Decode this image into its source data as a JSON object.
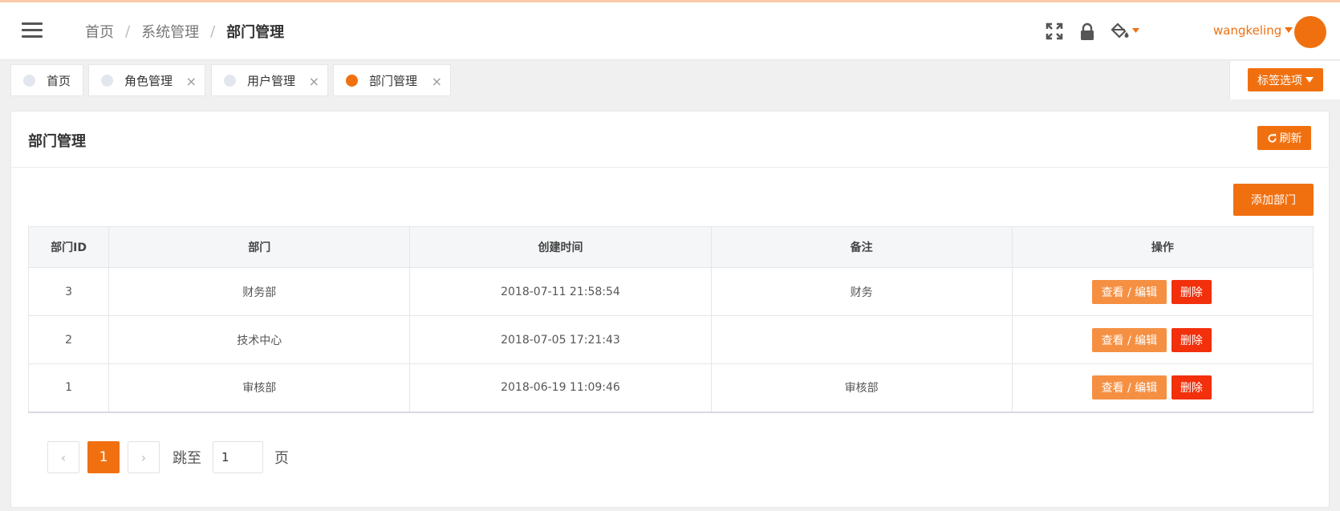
{
  "header": {
    "breadcrumb": [
      "首页",
      "系统管理",
      "部门管理"
    ],
    "separator": "/",
    "username": "wangkeling",
    "accent_color": "#f07010",
    "icons": [
      "fullscreen-icon",
      "lock-icon",
      "paint-bucket-icon"
    ]
  },
  "tabs": {
    "items": [
      {
        "label": "首页",
        "active": false,
        "closable": false
      },
      {
        "label": "角色管理",
        "active": false,
        "closable": true
      },
      {
        "label": "用户管理",
        "active": false,
        "closable": true
      },
      {
        "label": "部门管理",
        "active": true,
        "closable": true
      }
    ],
    "close_glyph": "×",
    "options_label": "标签选项"
  },
  "card": {
    "title": "部门管理",
    "refresh_label": "刷新",
    "add_label": "添加部门"
  },
  "table": {
    "columns": [
      "部门ID",
      "部门",
      "创建时间",
      "备注",
      "操作"
    ],
    "rows": [
      {
        "id": "3",
        "name": "财务部",
        "created": "2018-07-11 21:58:54",
        "remark": "财务"
      },
      {
        "id": "2",
        "name": "技术中心",
        "created": "2018-07-05 17:21:43",
        "remark": ""
      },
      {
        "id": "1",
        "name": "审核部",
        "created": "2018-06-19 11:09:46",
        "remark": "审核部"
      }
    ],
    "edit_label": "查看 / 编辑",
    "delete_label": "删除"
  },
  "pager": {
    "prev": "‹",
    "current": "1",
    "next": "›",
    "jump_label": "跳至",
    "jump_value": "1",
    "page_suffix": "页"
  }
}
